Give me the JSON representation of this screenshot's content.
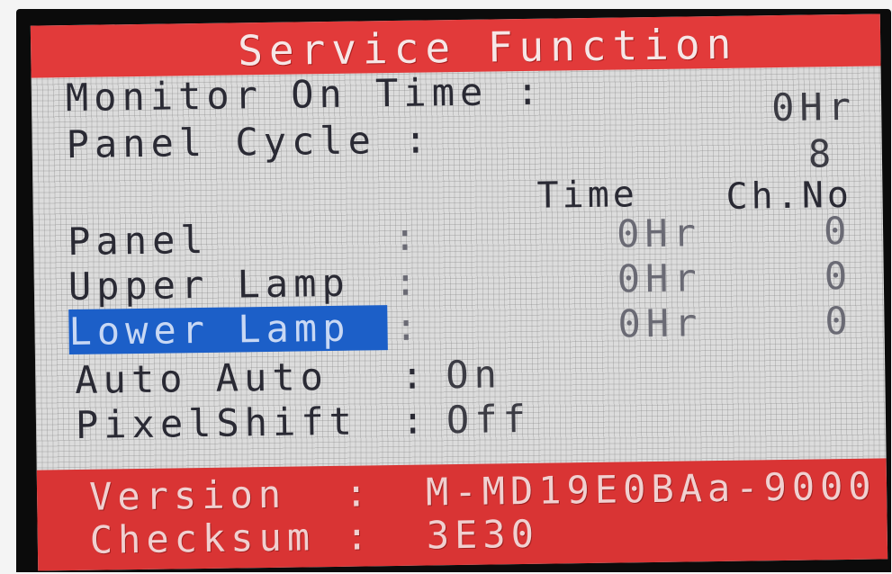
{
  "osd": {
    "title": "Service Function",
    "monitor_on_time": {
      "label": "Monitor On Time :",
      "value": "0Hr"
    },
    "panel_cycle": {
      "label": "Panel Cycle :",
      "value": "8"
    },
    "columns": {
      "time": "Time",
      "ch_no": "Ch.No"
    },
    "rows": [
      {
        "label": "Panel",
        "colon": ":",
        "time": "0Hr",
        "ch": "0"
      },
      {
        "label": "Upper Lamp",
        "colon": ":",
        "time": "0Hr",
        "ch": "0"
      },
      {
        "label": "Lower Lamp",
        "colon": ":",
        "time": "0Hr",
        "ch": "0"
      }
    ],
    "auto_auto": {
      "label": "Auto Auto",
      "colon": ":",
      "value": "On"
    },
    "pixel_shift": {
      "label": "PixelShift",
      "colon": ":",
      "value": "Off"
    },
    "version": {
      "label": "Version",
      "colon": ":",
      "value": "M-MD19E0BAa-9000"
    },
    "checksum": {
      "label": "Checksum",
      "colon": ":",
      "value": "3E30"
    }
  },
  "colors": {
    "title_bar": "#e23a3a",
    "footer_bar": "#d93434",
    "selection": "#1c5fc8",
    "background": "#dcdcdc"
  }
}
